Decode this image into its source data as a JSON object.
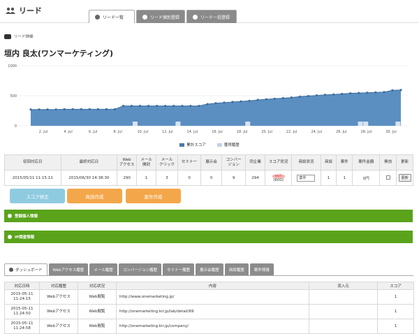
{
  "app": {
    "title": "リード"
  },
  "tabs": [
    {
      "label": "リード一覧",
      "active": true
    },
    {
      "label": "リード個別登録",
      "active": false
    },
    {
      "label": "リード一括登録",
      "active": false
    }
  ],
  "section": {
    "label": "リード詳細"
  },
  "lead": {
    "name": "垣内 良太(ワンマーケティング)"
  },
  "chart_data": {
    "type": "area",
    "ylim": [
      0,
      1000
    ],
    "yticks": [
      "1000",
      "500",
      "0"
    ],
    "xticks": [
      "2. Jul",
      "4. Jul",
      "6. Jul",
      "8. Jul",
      "10. Jul",
      "12. Jul",
      "14. Jul",
      "16. Jul",
      "18. Jul",
      "20. Jul",
      "22. Jul",
      "24. Jul",
      "26. Jul",
      "28. Jul",
      "30. Jul"
    ],
    "series": [
      {
        "name": "累計スコア",
        "color": "#5b8fc2",
        "values": [
          270,
          270,
          270,
          270,
          275,
          275,
          275,
          275,
          275,
          275,
          275,
          330,
          330,
          330,
          330,
          330,
          330,
          330,
          330,
          330,
          330,
          360,
          375,
          385,
          395,
          405,
          415,
          430,
          440,
          450,
          460,
          470,
          485,
          495,
          505,
          515,
          520,
          530,
          540,
          545,
          550,
          555,
          560,
          590,
          595
        ]
      },
      {
        "name": "獲得履歴",
        "color": "#bcd3ea",
        "values": [
          0,
          0,
          0,
          0,
          0,
          0,
          0,
          0,
          0,
          0,
          0,
          0,
          0,
          0,
          0,
          0,
          0,
          0,
          0,
          0,
          0,
          0,
          0,
          0,
          0,
          0,
          0,
          0,
          0,
          0,
          0,
          0,
          0,
          0,
          0,
          0,
          0,
          0,
          0,
          0,
          0,
          0,
          0,
          0,
          0
        ]
      }
    ]
  },
  "summary": {
    "headers": [
      "初回対応日",
      "最終対応日",
      "Web\nアクセス",
      "メール\n開封",
      "メール\nクリック",
      "セミナー",
      "展示会",
      "コンバー\nジョン",
      "同企業",
      "スコア状況",
      "商談状況",
      "商談",
      "案件",
      "案件金額",
      "無効",
      "更新"
    ],
    "row": {
      "first": "2015/05/11 11:15:11",
      "last": "2015/06/30 14:38:30",
      "web": "290",
      "mail_open": "1",
      "mail_click": "3",
      "seminar": "0",
      "expo": "0",
      "conversion": "9",
      "same_company": "294",
      "score_badge": "HOT",
      "score_value": "(600)",
      "deal_status": "案件",
      "deals": "1",
      "projects": "1",
      "amount": "0円",
      "update_label": "更新"
    }
  },
  "buttons": {
    "score": "スコア修正",
    "meeting": "商談作成",
    "project": "案件作成"
  },
  "panels": {
    "personal": "登録個人情報",
    "ip": "IP調査情報"
  },
  "subtabs": [
    "ダッシュボード",
    "Webアクセス履歴",
    "メール履歴",
    "コンバージョン履歴",
    "セミナー履歴",
    "展示会履歴",
    "商談履歴",
    "案件情報"
  ],
  "log": {
    "headers": [
      "対応日時",
      "対応履歴",
      "対応状況",
      "内容",
      "流入元",
      "スコア"
    ],
    "rows": [
      {
        "date": "2015-05-11",
        "time": "11:24:15",
        "type": "Webアクセス",
        "status": "Web閲覧",
        "content": "http://www.onemarketing.jp/",
        "source": "",
        "score": "1"
      },
      {
        "date": "2015-05-11",
        "time": "11:24:50",
        "type": "Webアクセス",
        "status": "Web閲覧",
        "content": "http://onemarketing.kir.jp/lab/detail/69",
        "source": "",
        "score": "1"
      },
      {
        "date": "2015-05-11",
        "time": "11:24:58",
        "type": "Webアクセス",
        "status": "Web閲覧",
        "content": "http://onemarketing.kir.jp/company/",
        "source": "",
        "score": "1"
      }
    ]
  }
}
